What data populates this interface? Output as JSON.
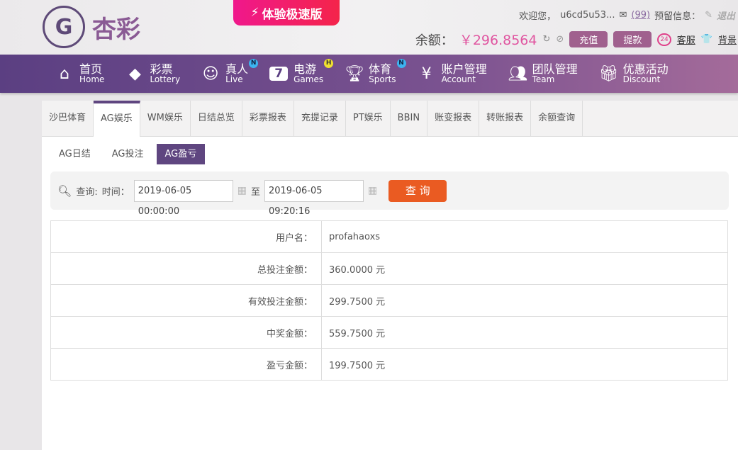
{
  "header": {
    "logo_text": "杏彩",
    "speed_label": "体验极速版",
    "welcome": "欢迎您，",
    "username": "u6cd5u53...",
    "mail_count": "(99)",
    "reserved_label": "预留信息：",
    "logout": "退出",
    "balance_label": "余额：",
    "balance": "￥296.8564",
    "recharge": "充值",
    "withdraw": "提款",
    "service": "客服",
    "background": "背景"
  },
  "nav": [
    {
      "cn": "首页",
      "en": "Home"
    },
    {
      "cn": "彩票",
      "en": "Lottery"
    },
    {
      "cn": "真人",
      "en": "Live",
      "badge": "N"
    },
    {
      "cn": "电游",
      "en": "Games",
      "badge": "H"
    },
    {
      "cn": "体育",
      "en": "Sports",
      "badge": "N"
    },
    {
      "cn": "账户管理",
      "en": "Account"
    },
    {
      "cn": "团队管理",
      "en": "Team"
    },
    {
      "cn": "优惠活动",
      "en": "Discount"
    }
  ],
  "tabs": [
    "沙巴体育",
    "AG娱乐",
    "WM娱乐",
    "日结总览",
    "彩票报表",
    "充提记录",
    "PT娱乐",
    "BBIN",
    "账变报表",
    "转账报表",
    "余额查询"
  ],
  "subtabs": [
    "AG日结",
    "AG投注",
    "AG盈亏"
  ],
  "search": {
    "label": "查询:",
    "time_label": "时间：",
    "start": "2019-06-05 00:00:00",
    "to": "至",
    "end": "2019-06-05 09:20:16",
    "button": "查 询"
  },
  "rows": [
    {
      "k": "用户名：",
      "v": "profahaoxs"
    },
    {
      "k": "总投注金额：",
      "v": "360.0000 元"
    },
    {
      "k": "有效投注金额：",
      "v": "299.7500 元"
    },
    {
      "k": "中奖金额：",
      "v": "559.7500 元"
    },
    {
      "k": "盈亏金额：",
      "v": "199.7500 元"
    }
  ]
}
